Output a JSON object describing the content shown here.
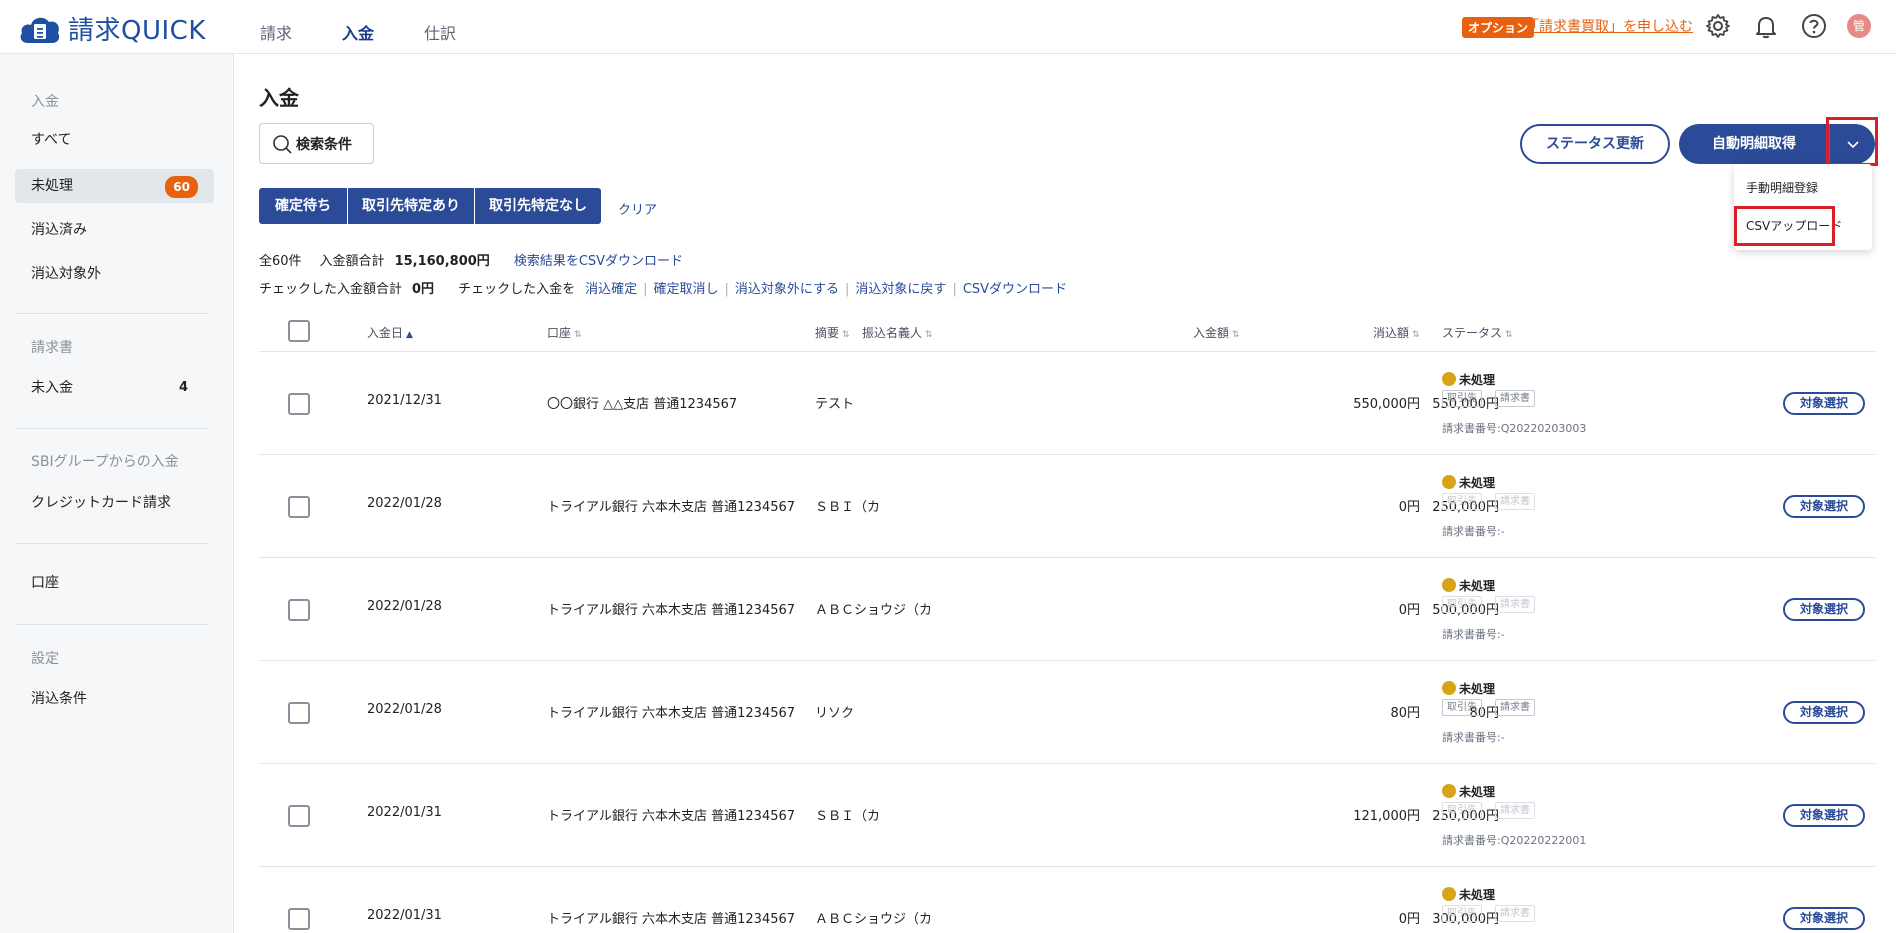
{
  "app": {
    "logo_text": "請求QUICK"
  },
  "topnav": [
    {
      "label": "請求"
    },
    {
      "label": "入金"
    },
    {
      "label": "仕訳"
    }
  ],
  "option": {
    "badge": "オプション",
    "link": "「請求書買取」を申し込む"
  },
  "user": {
    "avatar": "管"
  },
  "sidebar": {
    "section1": "入金",
    "items1": [
      {
        "label": "すべて"
      },
      {
        "label": "未処理",
        "badge": "60"
      },
      {
        "label": "消込済み"
      },
      {
        "label": "消込対象外"
      }
    ],
    "section2": "請求書",
    "items2": [
      {
        "label": "未入金",
        "count": "4"
      }
    ],
    "section3": "SBIグループからの入金",
    "items3": [
      {
        "label": "クレジットカード請求"
      }
    ],
    "items4": [
      {
        "label": "口座"
      }
    ],
    "section5": "設定",
    "items5": [
      {
        "label": "消込条件"
      }
    ]
  },
  "main": {
    "title": "入金",
    "search_label": "検索条件",
    "status_update": "ステータス更新",
    "auto_fetch": "自動明細取得",
    "dropdown": {
      "manual": "手動明細登録",
      "csv_upload": "CSVアップロード"
    },
    "filters": [
      "確定待ち",
      "取引先特定あり",
      "取引先特定なし"
    ],
    "clear": "クリア",
    "summary": {
      "total_count": "全60件",
      "amount_label": "入金額合計",
      "amount_value": "15,160,800円",
      "csv_download": "検索結果をCSVダウンロード",
      "checked_label": "チェックした入金額合計",
      "checked_value": "0円",
      "checked_action": "チェックした入金を",
      "actions": [
        "消込確定",
        "確定取消し",
        "消込対象外にする",
        "消込対象に戻す",
        "CSVダウンロード"
      ]
    },
    "columns": {
      "date": "入金日",
      "account": "口座",
      "memo": "摘要",
      "payer": "振込名義人",
      "amount": "入金額",
      "applied": "消込額",
      "status": "ステータス"
    },
    "rows": [
      {
        "date": "2021/12/31",
        "account": "〇〇銀行 △△支店 普通1234567",
        "memo": "テスト",
        "amount": "550,000円",
        "applied": "550,000円",
        "status": "未処理",
        "chip1": "取引先",
        "chip2": "請求書",
        "dim": false,
        "invoice": "請求書番号:Q20220203003",
        "select": "対象選択"
      },
      {
        "date": "2022/01/28",
        "account": "トライアル銀行 六本木支店 普通1234567",
        "memo": "ＳＢＩ（カ",
        "amount": "250,000円",
        "applied": "0円",
        "status": "未処理",
        "chip1": "取引先",
        "chip2": "請求書",
        "dim": true,
        "invoice": "請求書番号:-",
        "select": "対象選択"
      },
      {
        "date": "2022/01/28",
        "account": "トライアル銀行 六本木支店 普通1234567",
        "memo": "ＡＢＣショウジ（カ",
        "amount": "500,000円",
        "applied": "0円",
        "status": "未処理",
        "chip1": "取引先",
        "chip2": "請求書",
        "dim": true,
        "invoice": "請求書番号:-",
        "select": "対象選択"
      },
      {
        "date": "2022/01/28",
        "account": "トライアル銀行 六本木支店 普通1234567",
        "memo": "リソク",
        "amount": "80円",
        "applied": "80円",
        "status": "未処理",
        "chip1": "取引先",
        "chip2": "請求書",
        "dim": false,
        "invoice": "請求書番号:-",
        "select": "対象選択"
      },
      {
        "date": "2022/01/31",
        "account": "トライアル銀行 六本木支店 普通1234567",
        "memo": "ＳＢＩ（カ",
        "amount": "250,000円",
        "applied": "121,000円",
        "status": "未処理",
        "chip1": "取引先",
        "chip2": "請求書",
        "dim": true,
        "invoice": "請求書番号:Q20220222001",
        "select": "対象選択"
      },
      {
        "date": "2022/01/31",
        "account": "トライアル銀行 六本木支店 普通1234567",
        "memo": "ＡＢＣショウジ（カ",
        "amount": "300,000円",
        "applied": "0円",
        "status": "未処理",
        "chip1": "取引先",
        "chip2": "請求書",
        "dim": true,
        "invoice": "",
        "select": "対象選択"
      }
    ]
  },
  "colors": {
    "primary": "#2b4a97",
    "accent": "#e8610f",
    "highlight": "#d9202a",
    "status_pending": "#d8a417"
  }
}
